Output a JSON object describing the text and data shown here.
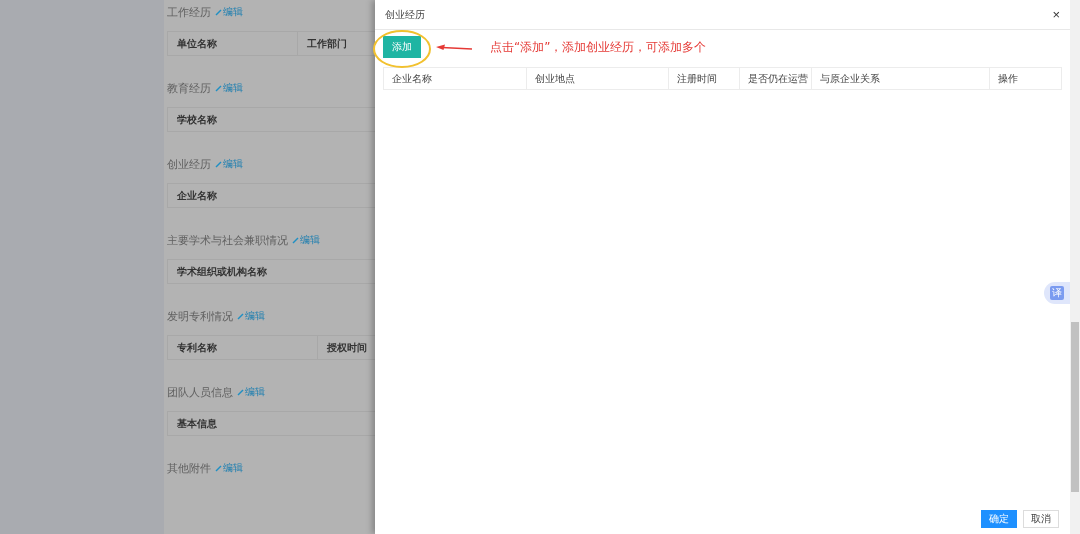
{
  "background_page": {
    "sections": [
      {
        "title": "工作经历",
        "edit_label": "编辑",
        "columns": [
          "单位名称",
          "工作部门"
        ]
      },
      {
        "title": "教育经历",
        "edit_label": "编辑",
        "columns": [
          "学校名称"
        ]
      },
      {
        "title": "创业经历",
        "edit_label": "编辑",
        "columns": [
          "企业名称"
        ]
      },
      {
        "title": "主要学术与社会兼职情况",
        "edit_label": "编辑",
        "columns": [
          "学术组织或机构名称"
        ]
      },
      {
        "title": "发明专利情况",
        "edit_label": "编辑",
        "columns": [
          "专利名称",
          "授权时间"
        ]
      },
      {
        "title": "团队人员信息",
        "edit_label": "编辑",
        "columns": [
          "基本信息"
        ]
      },
      {
        "title": "其他附件",
        "edit_label": "编辑"
      }
    ]
  },
  "drawer": {
    "title": "创业经历",
    "close": "×",
    "add_button": "添加",
    "annotation": "点击“添加”，添加创业经历，可添加多个",
    "table": {
      "columns": [
        "企业名称",
        "创业地点",
        "注册时间",
        "是否仍在运营",
        "与原企业关系",
        "操作"
      ]
    },
    "buttons": [
      {
        "label": "确定",
        "kind": "primary"
      },
      {
        "label": "取消",
        "kind": "default"
      }
    ]
  },
  "translate_badge": "译"
}
